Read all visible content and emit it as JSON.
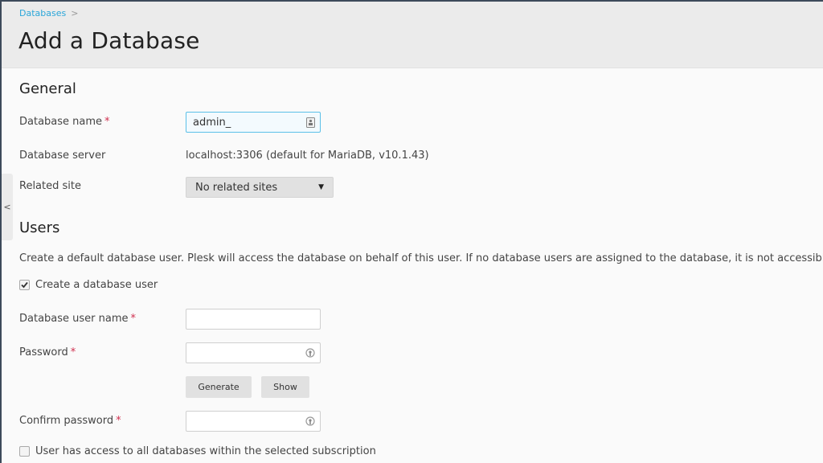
{
  "header": {
    "breadcrumb": [
      {
        "label": "Databases"
      }
    ],
    "breadcrumb_separator": ">",
    "title": "Add a Database"
  },
  "sidebar_toggle": {
    "icon": "chevron-left-icon",
    "glyph": "<"
  },
  "general": {
    "title": "General",
    "database_name": {
      "label": "Database name",
      "required_mark": "*",
      "value": "admin_",
      "icon": "id-card-icon"
    },
    "database_server": {
      "label": "Database server",
      "value": "localhost:3306 (default for MariaDB, v10.1.43)"
    },
    "related_site": {
      "label": "Related site",
      "selected": "No related sites",
      "caret": "▼"
    }
  },
  "users": {
    "title": "Users",
    "description": "Create a default database user. Plesk will access the database on behalf of this user. If no database users are assigned to the database, it is not accessible.",
    "create_user": {
      "label": "Create a database user",
      "checked": true
    },
    "user_name": {
      "label": "Database user name",
      "required_mark": "*",
      "value": ""
    },
    "password": {
      "label": "Password",
      "required_mark": "*",
      "value": "",
      "icon": "password-key-icon"
    },
    "generate_label": "Generate",
    "show_label": "Show",
    "confirm_password": {
      "label": "Confirm password",
      "required_mark": "*",
      "value": "",
      "icon": "password-key-icon"
    },
    "all_databases": {
      "label": "User has access to all databases within the selected subscription",
      "checked": false
    }
  },
  "colors": {
    "accent": "#2aa6d9",
    "required": "#d0304f",
    "header_bg": "#ebebeb",
    "page_bg": "#fafafa"
  }
}
